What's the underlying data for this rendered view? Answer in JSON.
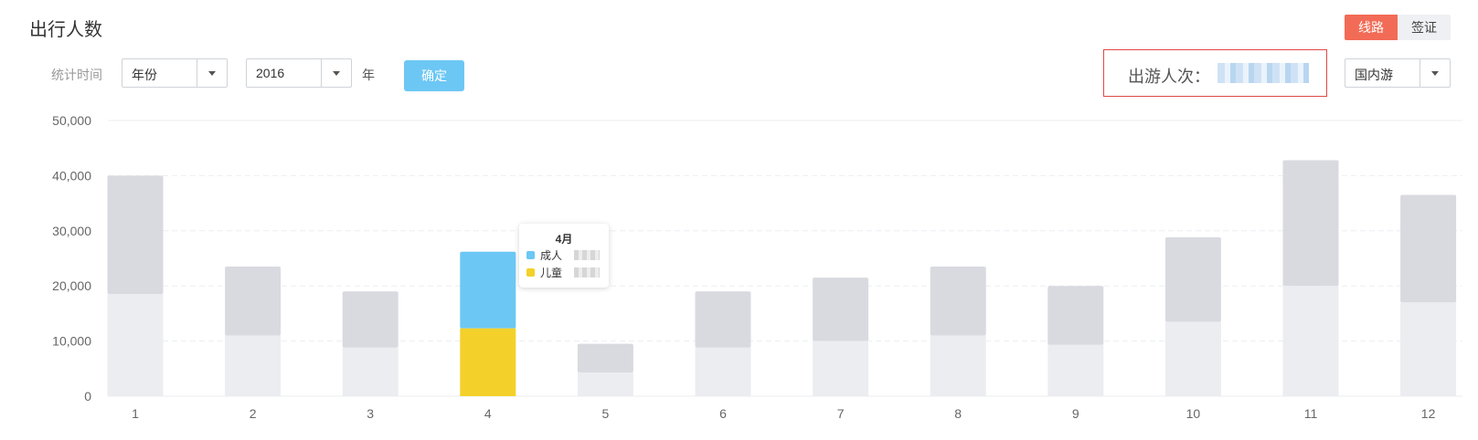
{
  "header": {
    "title": "出行人数"
  },
  "segments": {
    "route_label": "线路",
    "visa_label": "签证"
  },
  "filters": {
    "time_label": "统计时间",
    "period_select": "年份",
    "year_select": "2016",
    "year_unit": "年",
    "confirm_label": "确定",
    "scope_select": "国内游"
  },
  "summary": {
    "label": "出游人次：",
    "value": ""
  },
  "colors": {
    "accent": "#f26b56",
    "confirm": "#6cc7f4",
    "adult": "#6cc7f4",
    "child": "#f3d12a",
    "bar_top": "#d9dae0",
    "bar_bottom": "#ecedf1",
    "summary_border": "#e04848"
  },
  "tooltip": {
    "title": "4月",
    "rows": [
      {
        "label": "成人",
        "color": "#6cc7f4"
      },
      {
        "label": "儿童",
        "color": "#f3d12a"
      }
    ]
  },
  "chart_data": {
    "type": "bar",
    "stacked": true,
    "categories": [
      "1",
      "2",
      "3",
      "4",
      "5",
      "6",
      "7",
      "8",
      "9",
      "10",
      "11",
      "12"
    ],
    "series": [
      {
        "name": "儿童",
        "values": [
          18500,
          11000,
          8800,
          12300,
          4300,
          8800,
          10000,
          11000,
          9300,
          13500,
          20000,
          17000
        ]
      },
      {
        "name": "成人",
        "values": [
          21500,
          12500,
          10200,
          13900,
          5200,
          10200,
          11500,
          12500,
          10700,
          15300,
          22800,
          19500
        ]
      }
    ],
    "yticks": [
      "0",
      "10,000",
      "20,000",
      "30,000",
      "40,000",
      "50,000"
    ],
    "ylim": [
      0,
      50000
    ],
    "highlight_index": 3,
    "grid": true
  }
}
